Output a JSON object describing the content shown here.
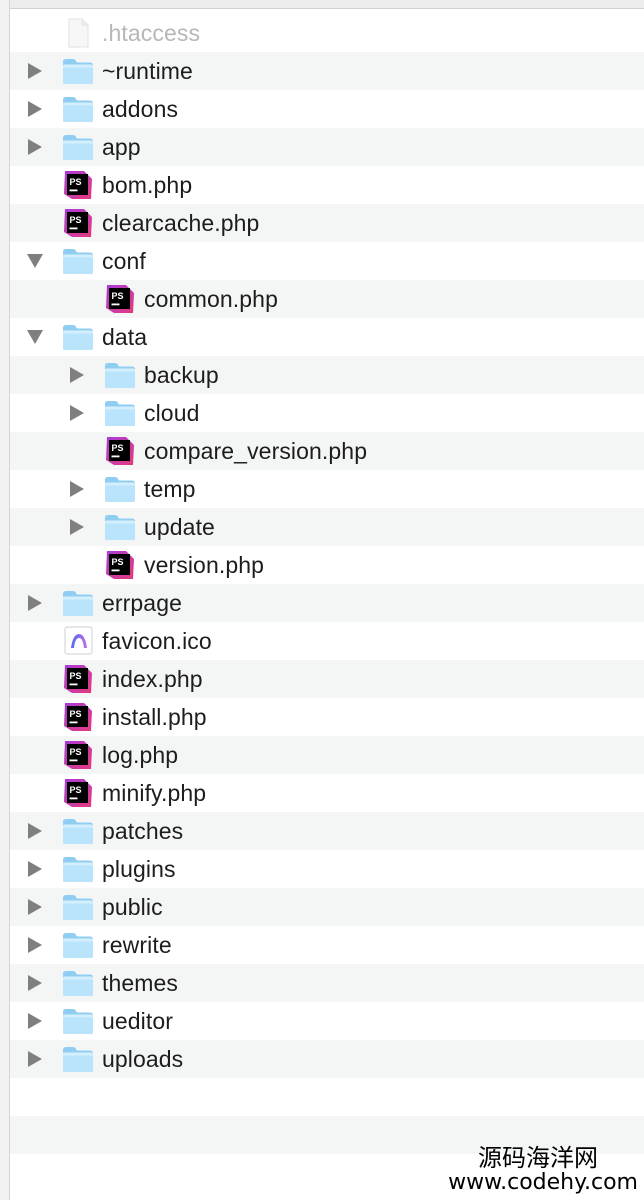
{
  "colors": {
    "folder_light": "#b9e4fb",
    "folder_dark": "#8fcdf2",
    "phpstorm_purple": "#a93cd9",
    "phpstorm_pink": "#e53a7c",
    "row_stripe": "#f4f5f5",
    "disclosure": "#7f7f7f"
  },
  "tree": {
    "items": [
      {
        "label": ".htaccess",
        "icon": "document-icon",
        "level": 0,
        "disclosure": "none",
        "dim": true
      },
      {
        "label": "~runtime",
        "icon": "folder-icon",
        "level": 0,
        "disclosure": "collapsed"
      },
      {
        "label": "addons",
        "icon": "folder-icon",
        "level": 0,
        "disclosure": "collapsed"
      },
      {
        "label": "app",
        "icon": "folder-icon",
        "level": 0,
        "disclosure": "collapsed"
      },
      {
        "label": "bom.php",
        "icon": "phpstorm-icon",
        "level": 0,
        "disclosure": "none"
      },
      {
        "label": "clearcache.php",
        "icon": "phpstorm-icon",
        "level": 0,
        "disclosure": "none"
      },
      {
        "label": "conf",
        "icon": "folder-icon",
        "level": 0,
        "disclosure": "expanded"
      },
      {
        "label": "common.php",
        "icon": "phpstorm-icon",
        "level": 1,
        "disclosure": "none"
      },
      {
        "label": "data",
        "icon": "folder-icon",
        "level": 0,
        "disclosure": "expanded"
      },
      {
        "label": "backup",
        "icon": "folder-icon",
        "level": 1,
        "disclosure": "collapsed"
      },
      {
        "label": "cloud",
        "icon": "folder-icon",
        "level": 1,
        "disclosure": "collapsed"
      },
      {
        "label": "compare_version.php",
        "icon": "phpstorm-icon",
        "level": 1,
        "disclosure": "none"
      },
      {
        "label": "temp",
        "icon": "folder-icon",
        "level": 1,
        "disclosure": "collapsed"
      },
      {
        "label": "update",
        "icon": "folder-icon",
        "level": 1,
        "disclosure": "collapsed"
      },
      {
        "label": "version.php",
        "icon": "phpstorm-icon",
        "level": 1,
        "disclosure": "none"
      },
      {
        "label": "errpage",
        "icon": "folder-icon",
        "level": 0,
        "disclosure": "collapsed"
      },
      {
        "label": "favicon.ico",
        "icon": "favicon-icon",
        "level": 0,
        "disclosure": "none"
      },
      {
        "label": "index.php",
        "icon": "phpstorm-icon",
        "level": 0,
        "disclosure": "none"
      },
      {
        "label": "install.php",
        "icon": "phpstorm-icon",
        "level": 0,
        "disclosure": "none"
      },
      {
        "label": "log.php",
        "icon": "phpstorm-icon",
        "level": 0,
        "disclosure": "none"
      },
      {
        "label": "minify.php",
        "icon": "phpstorm-icon",
        "level": 0,
        "disclosure": "none"
      },
      {
        "label": "patches",
        "icon": "folder-icon",
        "level": 0,
        "disclosure": "collapsed"
      },
      {
        "label": "plugins",
        "icon": "folder-icon",
        "level": 0,
        "disclosure": "collapsed"
      },
      {
        "label": "public",
        "icon": "folder-icon",
        "level": 0,
        "disclosure": "collapsed"
      },
      {
        "label": "rewrite",
        "icon": "folder-icon",
        "level": 0,
        "disclosure": "collapsed"
      },
      {
        "label": "themes",
        "icon": "folder-icon",
        "level": 0,
        "disclosure": "collapsed"
      },
      {
        "label": "ueditor",
        "icon": "folder-icon",
        "level": 0,
        "disclosure": "collapsed"
      },
      {
        "label": "uploads",
        "icon": "folder-icon",
        "level": 0,
        "disclosure": "collapsed"
      }
    ],
    "empty_rows": 3
  },
  "watermark": {
    "name": "源码海洋网",
    "url": "www.codehy.com"
  }
}
